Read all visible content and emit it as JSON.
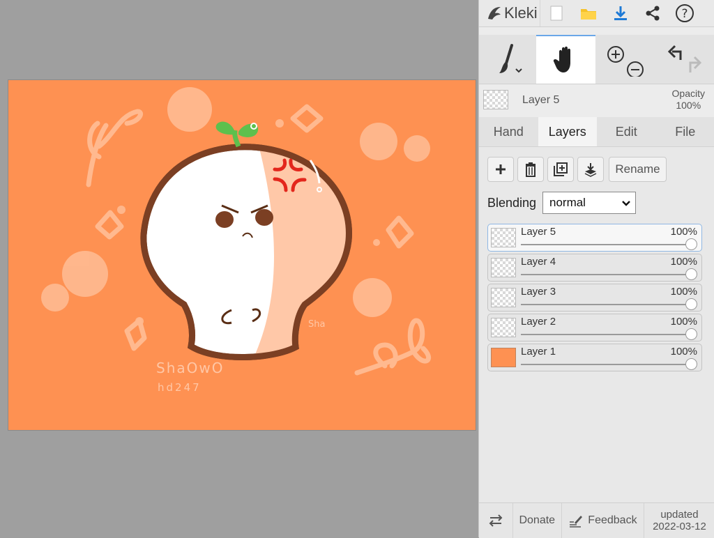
{
  "app": {
    "name": "Kleki"
  },
  "colors": {
    "canvas_bg": "#fe9152",
    "accent_blue": "#1e7ad6",
    "panel_bg": "#ececec"
  },
  "toolbar": {
    "icons": [
      "new-image-icon",
      "open-folder-icon",
      "download-icon",
      "share-icon",
      "help-icon"
    ]
  },
  "tools": {
    "brush": "brush-icon",
    "hand": "hand-icon",
    "zoom_in": "zoom-in-icon",
    "zoom_out": "zoom-out-icon",
    "undo": "undo-icon",
    "redo": "redo-icon"
  },
  "current_layer": {
    "name": "Layer 5",
    "opacity_label": "Opacity",
    "opacity_value": "100%"
  },
  "tabs": [
    {
      "label": "Hand",
      "active": false
    },
    {
      "label": "Layers",
      "active": true
    },
    {
      "label": "Edit",
      "active": false
    },
    {
      "label": "File",
      "active": false
    }
  ],
  "layer_actions": {
    "rename_label": "Rename",
    "icons": [
      "add-layer-icon",
      "delete-layer-icon",
      "duplicate-layer-icon",
      "merge-down-icon"
    ]
  },
  "blending": {
    "label": "Blending",
    "value": "normal"
  },
  "layers": [
    {
      "name": "Layer 5",
      "opacity": "100%",
      "active": true
    },
    {
      "name": "Layer 4",
      "opacity": "100%",
      "active": false
    },
    {
      "name": "Layer 3",
      "opacity": "100%",
      "active": false
    },
    {
      "name": "Layer 2",
      "opacity": "100%",
      "active": false
    },
    {
      "name": "Layer 1",
      "opacity": "100%",
      "active": false
    }
  ],
  "footer": {
    "donate": "Donate",
    "feedback": "Feedback",
    "updated_label": "updated",
    "updated_date": "2022-03-12"
  },
  "artwork": {
    "signature_line1": "ShaOwO",
    "signature_line2": "hd247",
    "small_text": "Sha"
  }
}
